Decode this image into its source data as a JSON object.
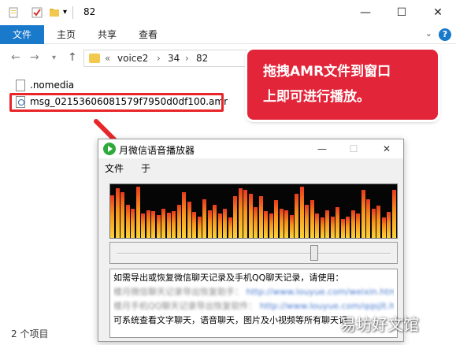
{
  "explorer": {
    "title": "82",
    "window_controls": {
      "minimize": "—",
      "maximize": "☐",
      "close": "✕"
    }
  },
  "ribbon": {
    "tabs": [
      "文件",
      "主页",
      "共享",
      "查看"
    ],
    "collapse": "⌄",
    "help": "?"
  },
  "address": {
    "prefix": "«",
    "crumbs": [
      "voice2",
      "34",
      "82"
    ],
    "separators": [
      "›",
      "›"
    ]
  },
  "files": [
    {
      "name": ".nomedia"
    },
    {
      "name": "msg_02153606081579f7950d0df100.amr"
    }
  ],
  "status": {
    "count": "2 个项目"
  },
  "callout": {
    "line1": "拖拽AMR文件到窗口",
    "line2": "上即可进行播放。"
  },
  "player": {
    "title": "月微信语音播放器",
    "menu": [
      "文件",
      "于"
    ],
    "info_lines": [
      "如需导出或恢复微信聊天记录及手机QQ聊天记录，请使用：",
      "可系统查看文字聊天，语音聊天，图片及小视频等所有聊天记"
    ],
    "blurred_text_1": "楼月微信聊天记录导出恢复助手：",
    "blurred_link_1": "http://www.louyue.com/weixin.htm",
    "blurred_text_2": "楼月手机QQ聊天记录导出恢复软件：",
    "blurred_link_2": "http://www.louyue.com/qqsjlt.htm"
  },
  "spectrum": {
    "levels": [
      0.8,
      0.92,
      0.85,
      0.62,
      0.55,
      0.95,
      0.45,
      0.52,
      0.5,
      0.42,
      0.55,
      0.47,
      0.5,
      0.62,
      0.85,
      0.68,
      0.48,
      0.4,
      0.72,
      0.52,
      0.62,
      0.45,
      0.55,
      0.38,
      0.78,
      0.92,
      0.9,
      0.82,
      0.58,
      0.78,
      0.5,
      0.45,
      0.7,
      0.55,
      0.52,
      0.42,
      0.82,
      0.95,
      0.62,
      0.7,
      0.45,
      0.38,
      0.52,
      0.4,
      0.58,
      0.35,
      0.4,
      0.52,
      0.45,
      0.9,
      0.72,
      0.55,
      0.6,
      0.38,
      0.48,
      0.9
    ],
    "colors": {
      "top": "#e83a1e",
      "mid": "#f7941d",
      "bottom": "#fbd33a"
    }
  },
  "slider": {
    "position": 0.72
  },
  "watermark": "易坊好文馆"
}
